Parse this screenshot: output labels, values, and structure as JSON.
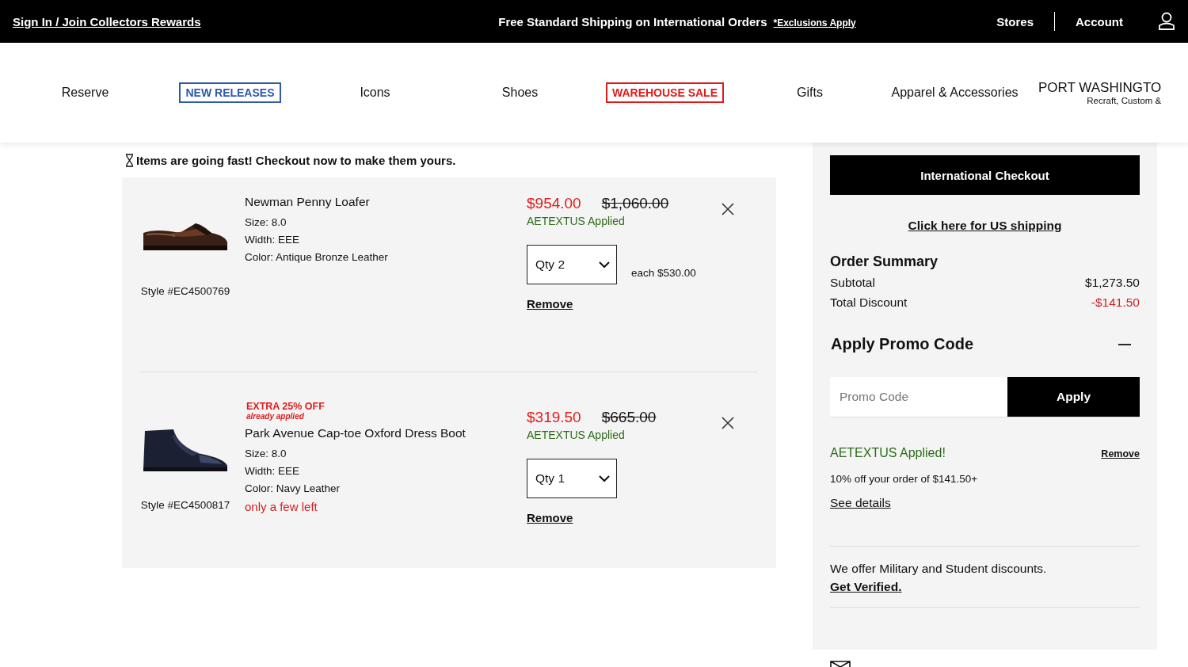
{
  "top_bar": {
    "sign_in_link": "Sign In / Join Collectors Rewards",
    "shipping_message": "Free Standard Shipping on International Orders",
    "exclusions_link": "*Exclusions Apply",
    "links": [
      "Stores",
      "Account"
    ]
  },
  "nav": {
    "items": [
      {
        "label": "Reserve",
        "kind": "plain"
      },
      {
        "label": "NEW RELEASES",
        "kind": "boxed",
        "color": "#2f5aa8"
      },
      {
        "label": "Icons",
        "kind": "plain"
      },
      {
        "label": "Shoes",
        "kind": "plain"
      },
      {
        "label": "WAREHOUSE SALE",
        "kind": "boxed",
        "color": "#e01b1b"
      },
      {
        "label": "Gifts",
        "kind": "plain"
      },
      {
        "label": "Apparel & Accessories",
        "kind": "plain"
      }
    ],
    "store": {
      "name": "PORT WASHINGTO",
      "subtitle": "Recraft, Custom &"
    }
  },
  "urgency_message": "Items are going fast! Checkout now to make them yours.",
  "cart_items": [
    {
      "name": "Newman Penny Loafer",
      "size": "Size: 8.0",
      "width": "Width: EEE",
      "color_label": "Color: Antique Bronze Leather",
      "style_number": "Style #EC4500769",
      "sale_price": "$954.00",
      "original_price": "$1,060.00",
      "promo_note": "AETEXTUS Applied",
      "quantity": "Qty 2",
      "unit_price": "each $530.00",
      "remove_link": "Remove"
    },
    {
      "badge": {
        "title": "EXTRA 25% OFF",
        "subtitle": "already applied"
      },
      "name": "Park Avenue Cap-toe Oxford Dress Boot",
      "size": "Size: 8.0",
      "width": "Width: EEE",
      "color_label": "Color: Navy Leather",
      "stock_note": "only a few left",
      "style_number": "Style #EC4500817",
      "sale_price": "$319.50",
      "original_price": "$665.00",
      "promo_note": "AETEXTUS Applied",
      "quantity": "Qty 1",
      "remove_link": "Remove"
    }
  ],
  "summary": {
    "checkout_button": "International Checkout",
    "us_shipping_link": "Click here for US shipping",
    "title": "Order Summary",
    "rows": [
      {
        "label": "Subtotal",
        "value": "$1,273.50",
        "kind": "normal"
      },
      {
        "label": "Total Discount",
        "value": "-$141.50",
        "kind": "discount"
      }
    ]
  },
  "promo": {
    "title": "Apply Promo Code",
    "expanded": true,
    "placeholder": "Promo Code",
    "apply_button": "Apply",
    "applied": {
      "message": "AETEXTUS Applied!",
      "remove_link": "Remove",
      "description": "10% off your order of $141.50+",
      "details_link": "See details"
    }
  },
  "military": {
    "text": "We offer Military and Student discounts.",
    "link": "Get Verified."
  }
}
